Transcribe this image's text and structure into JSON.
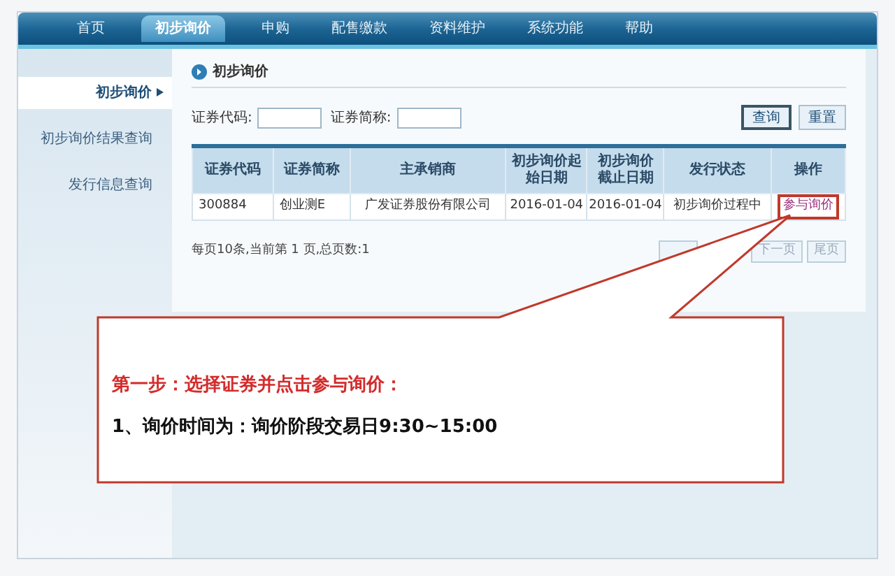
{
  "nav": [
    {
      "label": "首页",
      "selected": false
    },
    {
      "label": "初步询价",
      "selected": true
    },
    {
      "label": "申购",
      "selected": false
    },
    {
      "label": "配售缴款",
      "selected": false
    },
    {
      "label": "资料维护",
      "selected": false
    },
    {
      "label": "系统功能",
      "selected": false
    },
    {
      "label": "帮助",
      "selected": false
    }
  ],
  "sidebar": {
    "items": [
      {
        "label": "初步询价",
        "selected": true
      },
      {
        "label": "初步询价结果查询",
        "selected": false
      },
      {
        "label": "发行信息查询",
        "selected": false
      }
    ]
  },
  "panel_title": "初步询价",
  "search": {
    "fields": [
      {
        "label": "证券代码:"
      },
      {
        "label": "证券简称:"
      }
    ],
    "buttons": [
      {
        "label": "查询",
        "selected": true
      },
      {
        "label": "重置",
        "selected": false
      }
    ]
  },
  "table": {
    "columns": [
      "证券代码",
      "证券简称",
      "主承销商",
      "初步询价起始日期",
      "初步询价截止日期",
      "发行状态",
      "操作"
    ],
    "rows": [
      {
        "cells": [
          "300884",
          "创业测E",
          "广发证券股份有限公司",
          "2016-01-04",
          "2016-01-04",
          "初步询价过程中"
        ],
        "action": "参与询价"
      }
    ]
  },
  "pager": {
    "info": "每页10条,当前第 1 页,总页数:1",
    "buttons": [
      "下一页",
      "尾页"
    ]
  },
  "callout": {
    "title": "第一步：选择证券并点击参与询价：",
    "body": "1、询价时间为：询价阶段交易日9:30~15:00"
  }
}
